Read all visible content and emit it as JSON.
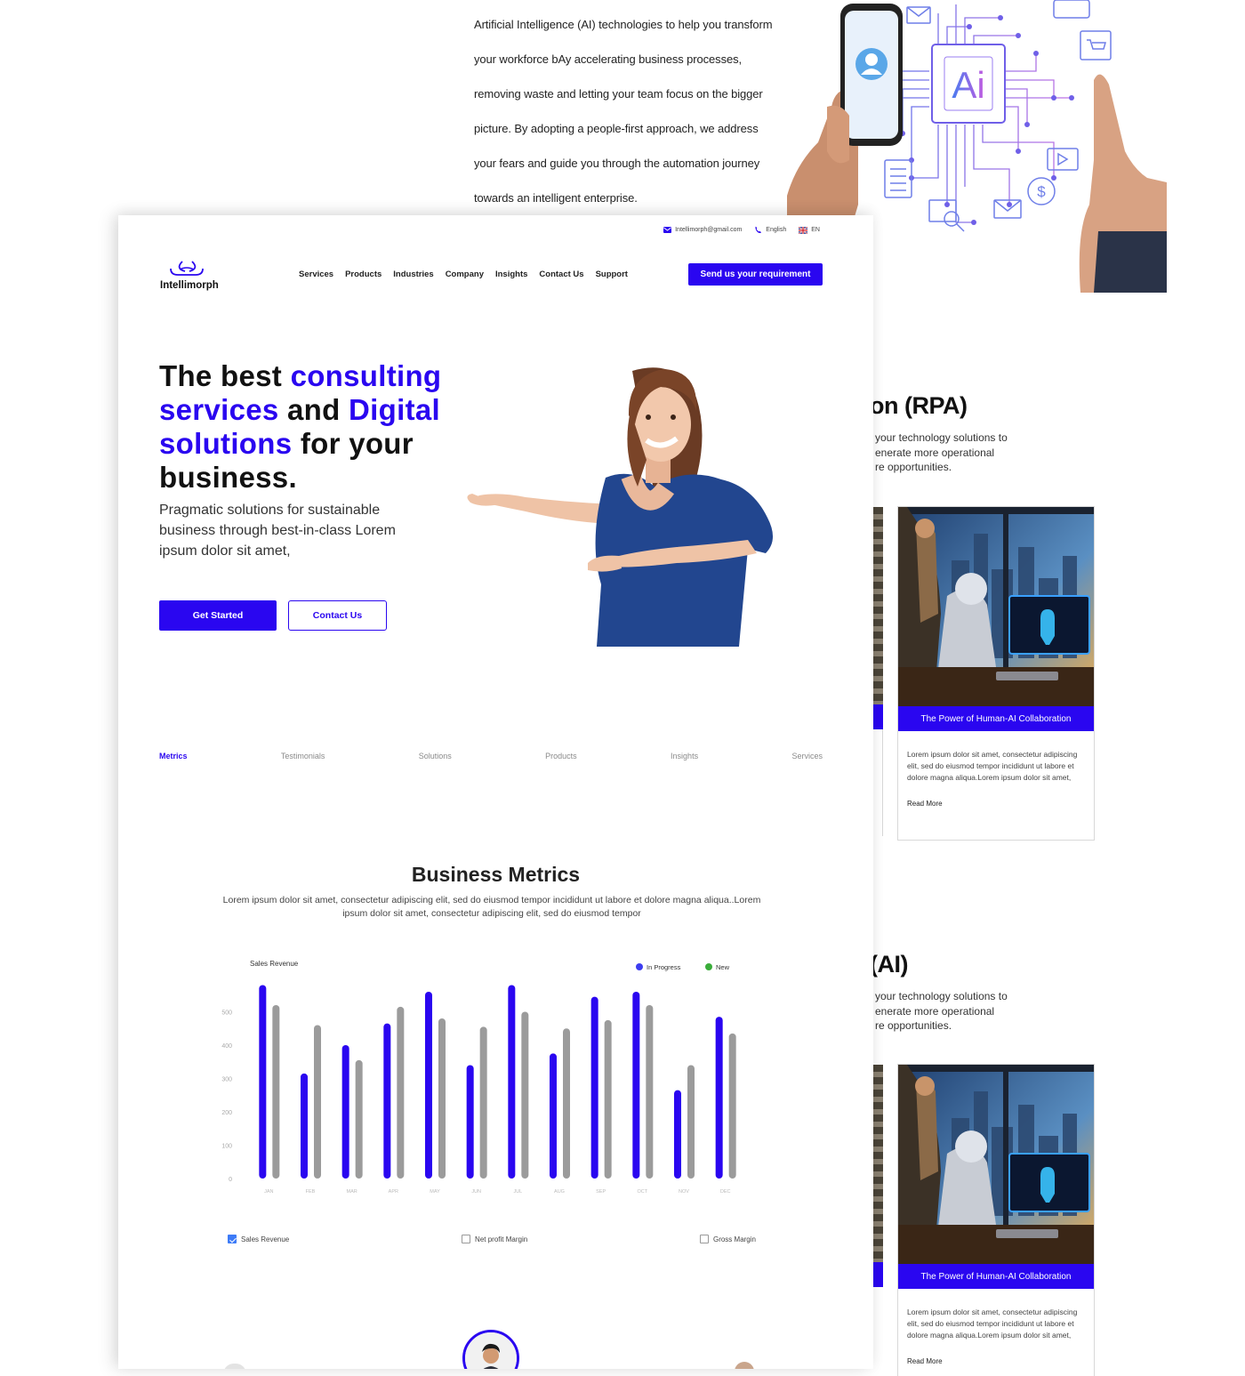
{
  "bg_page": {
    "paragraph_lines": [
      "Artificial Intelligence (AI) technologies to help you transform",
      "your workforce bAy accelerating business processes,",
      "removing waste and letting your team focus on the bigger",
      "picture. By adopting a people-first approach, we address",
      "your fears and guide you through the automation journey",
      "towards an intelligent enterprise."
    ],
    "ai_chip_label": "Ai",
    "section1": {
      "heading": "on (RPA)",
      "lines": [
        "your technology solutions to",
        "enerate more operational",
        "re opportunities."
      ]
    },
    "section2": {
      "heading": "(AI)",
      "lines": [
        "your technology solutions to",
        "enerate more operational",
        "re opportunities."
      ]
    },
    "card": {
      "caption": "The Power of Human-AI Collaboration",
      "body": "Lorem ipsum dolor sit amet, consectetur adipiscing elit, sed do eiusmod tempor incididunt ut labore et dolore magna aliqua.Lorem ipsum dolor sit amet,",
      "link": "Read More"
    }
  },
  "topbar": {
    "email": "Intellimorph@gmail.com",
    "language": "English",
    "locale": "EN"
  },
  "brand": {
    "name": "Intellimorph",
    "accent": "#2a06f0"
  },
  "nav": {
    "items": [
      "Services",
      "Products",
      "Industries",
      "Company",
      "Insights",
      "Contact Us",
      "Support"
    ],
    "cta": "Send us your requirement"
  },
  "hero": {
    "title": [
      {
        "text": "The best ",
        "accent": false
      },
      {
        "text": "consulting services",
        "accent": true
      },
      {
        "text": " and ",
        "accent": false
      },
      {
        "text": "Digital solutions",
        "accent": true
      },
      {
        "text": " for your business.",
        "accent": false
      }
    ],
    "subtitle": "Pragmatic solutions for sustainable business through best-in-class Lorem ipsum dolor sit amet,",
    "primary_button": "Get Started",
    "secondary_button": "Contact Us"
  },
  "tabs": [
    {
      "label": "Metrics",
      "active": true
    },
    {
      "label": "Testimonials",
      "active": false
    },
    {
      "label": "Solutions",
      "active": false
    },
    {
      "label": "Products",
      "active": false
    },
    {
      "label": "Insights",
      "active": false
    },
    {
      "label": "Services",
      "active": false
    }
  ],
  "metrics": {
    "title": "Business Metrics",
    "description": "Lorem ipsum dolor sit amet, consectetur adipiscing elit, sed do eiusmod tempor incididunt ut labore et dolore magna aliqua..Lorem ipsum dolor sit amet, consectetur adipiscing elit, sed do eiusmod tempor",
    "toggles": [
      {
        "label": "Sales Revenue",
        "checked": true
      },
      {
        "label": "Net profit Margin",
        "checked": false
      },
      {
        "label": "Gross Margin",
        "checked": false
      }
    ]
  },
  "chart_data": {
    "type": "bar",
    "title": "Sales Revenue",
    "categories": [
      "JAN",
      "FEB",
      "MAR",
      "APR",
      "MAY",
      "JUN",
      "JUL",
      "AUG",
      "SEP",
      "OCT",
      "NOV",
      "DEC"
    ],
    "series": [
      {
        "name": "In Progress",
        "color": "#2a06f0",
        "values": [
          580,
          315,
          400,
          465,
          560,
          340,
          580,
          375,
          545,
          560,
          265,
          485
        ]
      },
      {
        "name": "New",
        "color": "#9b9b9b",
        "values": [
          520,
          460,
          355,
          515,
          480,
          455,
          500,
          450,
          475,
          520,
          340,
          435
        ]
      }
    ],
    "legend_colors": [
      "#3d3df0",
      "#3aad3a"
    ],
    "yticks": [
      0,
      100,
      200,
      300,
      400,
      500
    ],
    "ylim": [
      0,
      600
    ],
    "grid": false,
    "legend": "top-right"
  }
}
